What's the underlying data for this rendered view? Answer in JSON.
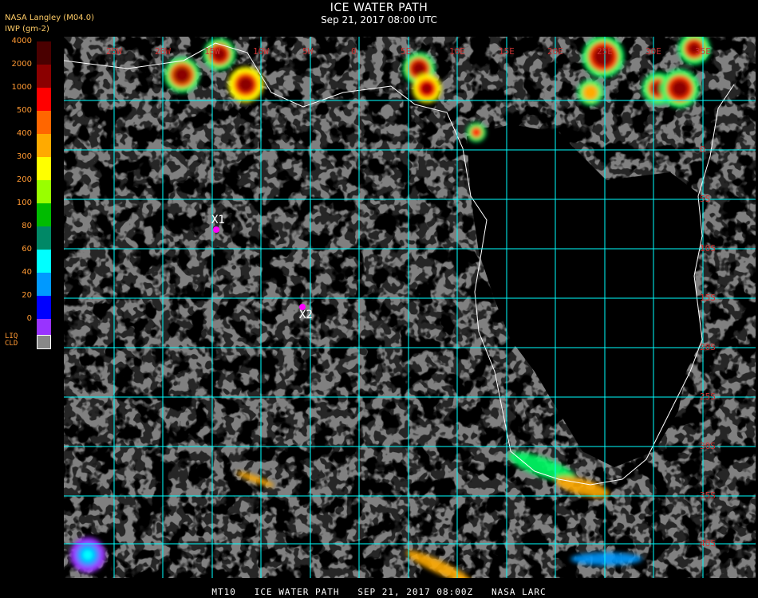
{
  "header": {
    "title": "ICE WATER PATH",
    "subtitle": "Sep 21, 2017 08:00 UTC",
    "org": "NASA Langley (M04.0)",
    "units": "IWP (gm-2)"
  },
  "legend": {
    "levels": [
      {
        "label": "4000",
        "color": "#4a0000"
      },
      {
        "label": "2000",
        "color": "#8b0000"
      },
      {
        "label": "1000",
        "color": "#ff0000"
      },
      {
        "label": "500",
        "color": "#ff6600"
      },
      {
        "label": "400",
        "color": "#ffaa00"
      },
      {
        "label": "300",
        "color": "#ffff00"
      },
      {
        "label": "200",
        "color": "#99ff00"
      },
      {
        "label": "100",
        "color": "#00bb00"
      },
      {
        "label": "80",
        "color": "#008866"
      },
      {
        "label": "60",
        "color": "#00ffff"
      },
      {
        "label": "40",
        "color": "#0099ff"
      },
      {
        "label": "20",
        "color": "#0000ff"
      },
      {
        "label": "0",
        "color": "#9933ff"
      }
    ],
    "liq_label_1": "LIQ",
    "liq_label_2": "CLD",
    "liq_color": "#888888"
  },
  "map": {
    "lon_labels": [
      "25W",
      "20W",
      "15W",
      "10W",
      "5W",
      "0",
      "5E",
      "10E",
      "15E",
      "20E",
      "25E",
      "30E",
      "35E"
    ],
    "lat_labels": [
      "0",
      "5S",
      "10S",
      "15S",
      "20S",
      "25S",
      "30S",
      "35S",
      "40S"
    ],
    "markers": [
      {
        "label": "X1",
        "color": "#ff00ff"
      },
      {
        "label": "X2",
        "color": "#ff00ff"
      }
    ],
    "grid_color": "#00ffff",
    "label_color": "#cc3333"
  },
  "footer": "MT10   ICE WATER PATH   SEP 21, 2017 08:00Z   NASA LARC"
}
